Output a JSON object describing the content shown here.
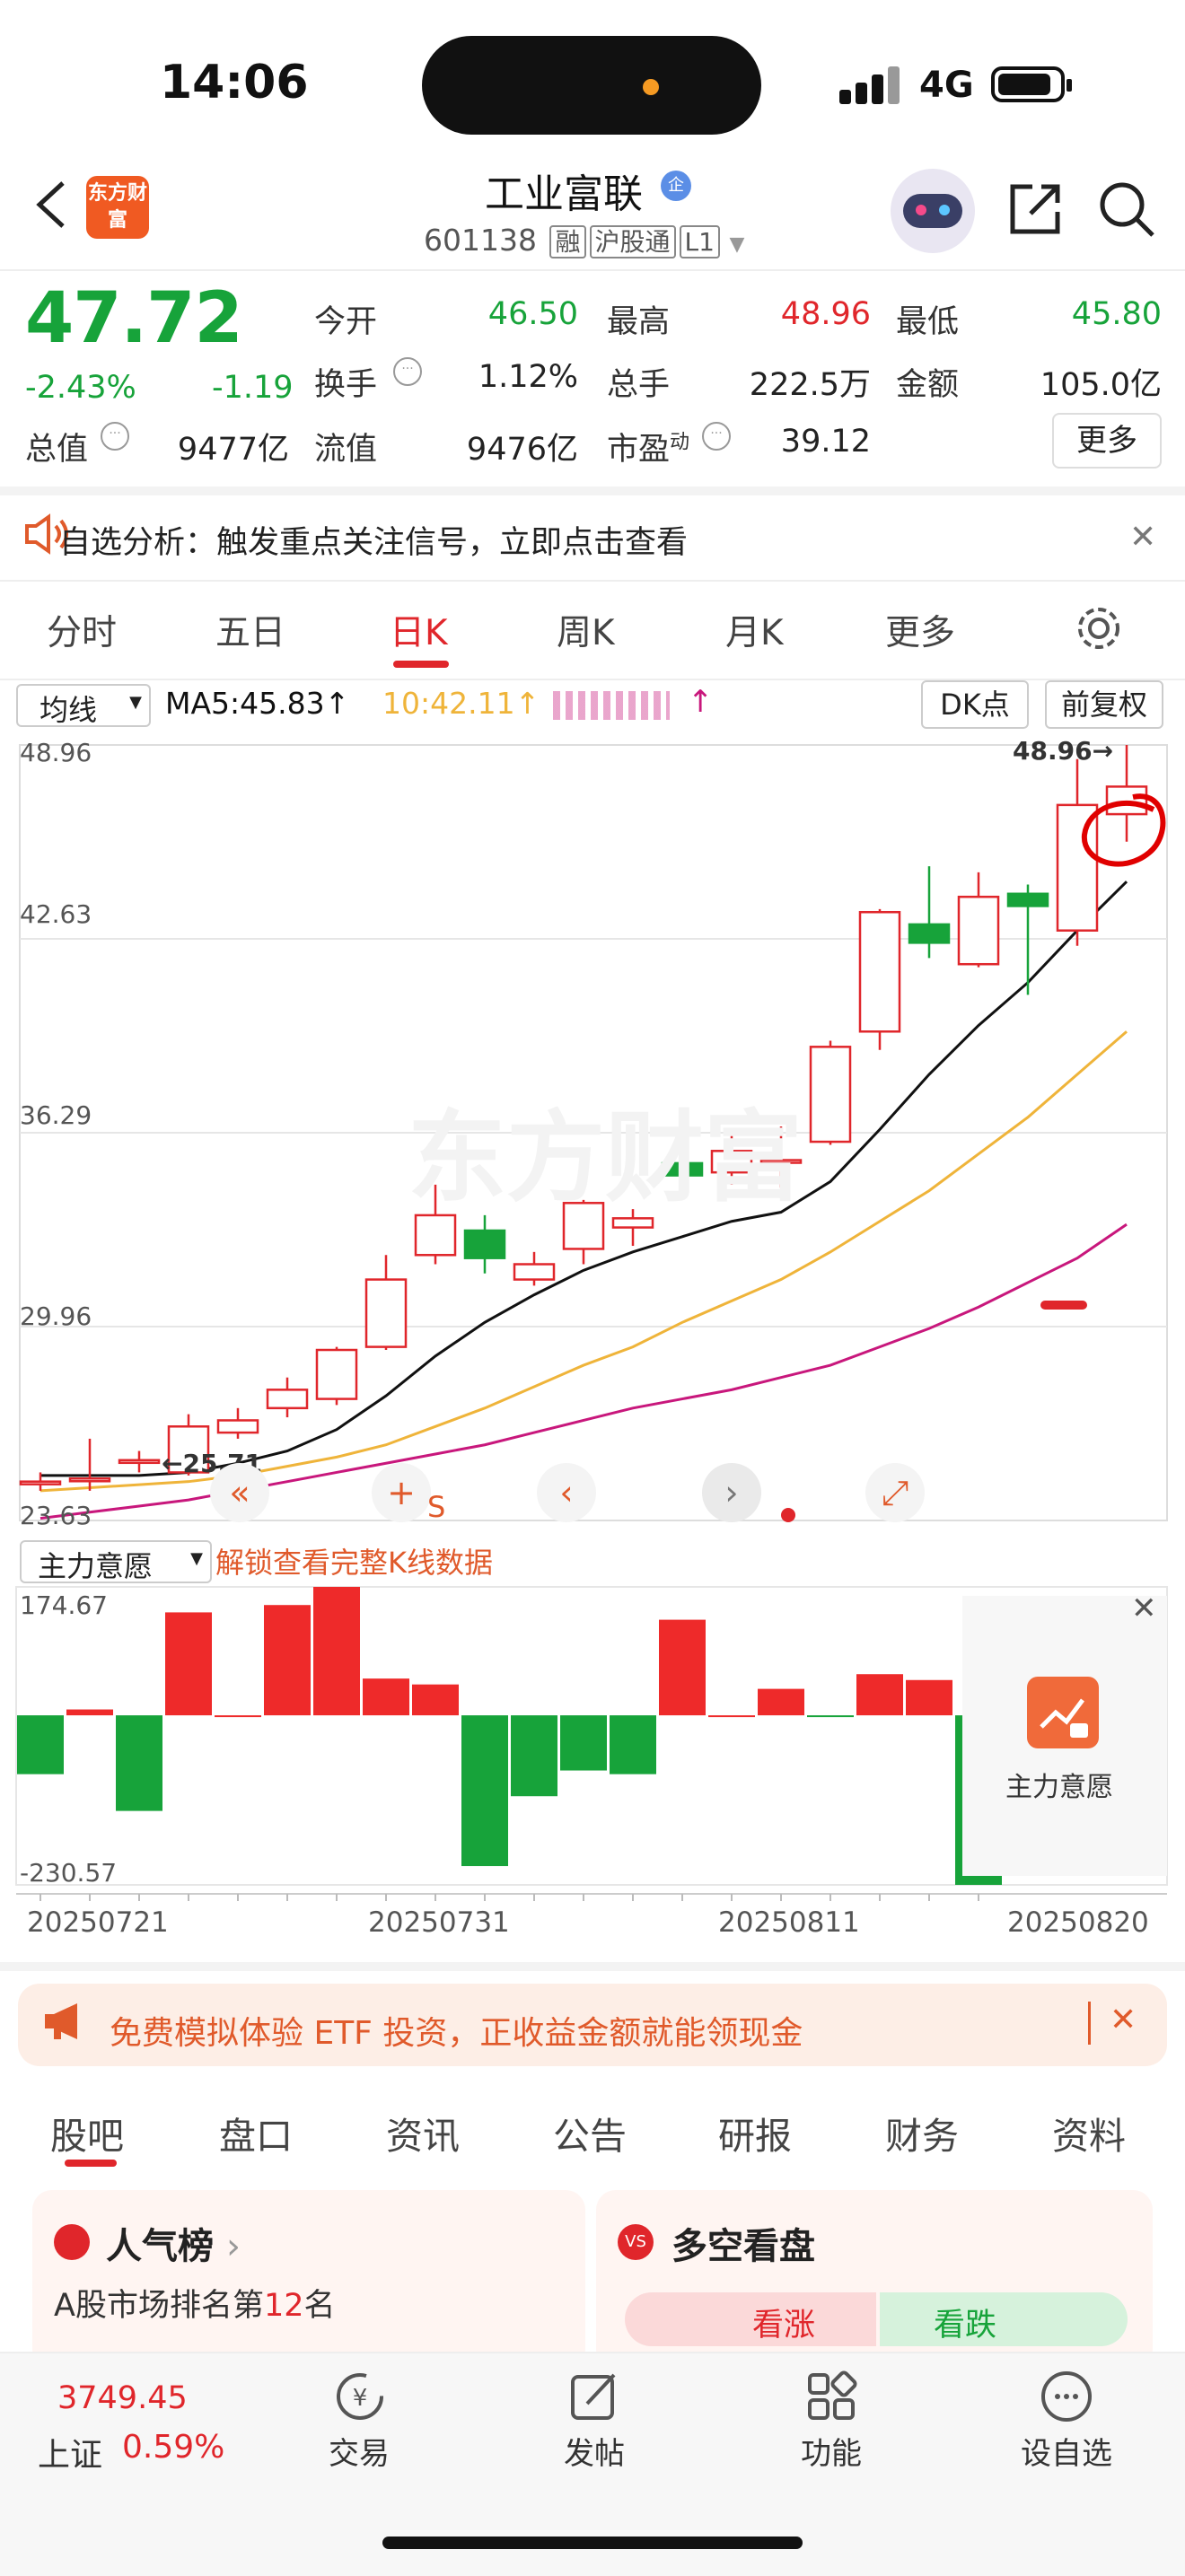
{
  "status": {
    "time": "14:06",
    "network": "4G"
  },
  "header": {
    "logo_text": "东方财富",
    "title": "工业富联",
    "title_badge": "企",
    "code": "601138",
    "tags": [
      "融",
      "沪股通",
      "L1"
    ]
  },
  "quote": {
    "price": "47.72",
    "change_pct": "-2.43%",
    "change_abs": "-1.19",
    "rows": [
      [
        {
          "label": "今开",
          "value": "46.50",
          "color": "#17a33a"
        },
        {
          "label": "最高",
          "value": "48.96",
          "color": "#e0262b"
        },
        {
          "label": "最低",
          "value": "45.80",
          "color": "#17a33a"
        }
      ],
      [
        {
          "label": "换手",
          "value": "1.12%",
          "color": "#222222"
        },
        {
          "label": "总手",
          "value": "222.5万",
          "color": "#222222"
        },
        {
          "label": "金额",
          "value": "105.0亿",
          "color": "#222222"
        }
      ]
    ],
    "total_value_label": "总值",
    "total_value": "9477亿",
    "float_value_label": "流值",
    "float_value": "9476亿",
    "pe_label": "市盈",
    "pe_sup": "动",
    "pe_value": "39.12",
    "more_label": "更多"
  },
  "notice": {
    "text": "自选分析：触发重点关注信号，立即点击查看"
  },
  "period_tabs": [
    "分时",
    "五日",
    "日K",
    "周K",
    "月K",
    "更多"
  ],
  "chart_toolbar": {
    "ma_select": "均线",
    "ma5": "MA5:45.83",
    "ma10": "10:42.11",
    "dk_label": "DK点",
    "adjust_label": "前复权",
    "max_marker": "48.96",
    "min_marker": "25.71"
  },
  "chart_data": [
    {
      "type": "candlestick",
      "title": "",
      "y_ticks": [
        "48.96",
        "42.63",
        "36.29",
        "29.96",
        "23.63"
      ],
      "ylim": [
        23.63,
        48.96
      ],
      "candles": [
        {
          "o": 24.9,
          "c": 24.9,
          "h": 25.2,
          "l": 24.6
        },
        {
          "o": 25.0,
          "c": 25.0,
          "h": 26.3,
          "l": 24.6
        },
        {
          "o": 25.6,
          "c": 25.6,
          "h": 25.9,
          "l": 25.2
        },
        {
          "o": 25.2,
          "c": 26.7,
          "h": 27.1,
          "l": 25.1
        },
        {
          "o": 26.5,
          "c": 26.9,
          "h": 27.3,
          "l": 26.3
        },
        {
          "o": 27.3,
          "c": 27.9,
          "h": 28.3,
          "l": 27.0
        },
        {
          "o": 27.6,
          "c": 29.2,
          "h": 29.3,
          "l": 27.4
        },
        {
          "o": 29.3,
          "c": 31.5,
          "h": 32.3,
          "l": 29.2
        },
        {
          "o": 32.3,
          "c": 33.6,
          "h": 34.6,
          "l": 32.0
        },
        {
          "o": 33.1,
          "c": 32.2,
          "h": 33.6,
          "l": 31.7
        },
        {
          "o": 31.5,
          "c": 32.0,
          "h": 32.4,
          "l": 31.3
        },
        {
          "o": 32.5,
          "c": 34.0,
          "h": 34.1,
          "l": 32.0
        },
        {
          "o": 33.2,
          "c": 33.5,
          "h": 33.8,
          "l": 32.6
        },
        {
          "o": 35.3,
          "c": 34.9,
          "h": 36.5,
          "l": 34.2
        },
        {
          "o": 35.0,
          "c": 35.7,
          "h": 36.3,
          "l": 34.6
        },
        {
          "o": 35.4,
          "c": 35.4,
          "h": 36.5,
          "l": 34.5
        },
        {
          "o": 36.0,
          "c": 39.1,
          "h": 39.3,
          "l": 35.9
        },
        {
          "o": 39.6,
          "c": 43.5,
          "h": 43.6,
          "l": 39.0
        },
        {
          "o": 43.1,
          "c": 42.5,
          "h": 45.0,
          "l": 42.0
        },
        {
          "o": 41.8,
          "c": 44.0,
          "h": 44.8,
          "l": 41.7
        },
        {
          "o": 44.1,
          "c": 43.7,
          "h": 44.4,
          "l": 40.8
        },
        {
          "o": 42.9,
          "c": 47.0,
          "h": 48.5,
          "l": 42.4
        },
        {
          "o": 46.7,
          "c": 47.6,
          "h": 48.96,
          "l": 45.8
        }
      ],
      "ma_lines": [
        {
          "name": "MA5",
          "values": [
            25.1,
            25.1,
            25.1,
            25.2,
            25.5,
            25.9,
            26.6,
            27.7,
            29.0,
            30.1,
            31.0,
            31.8,
            32.4,
            32.9,
            33.4,
            33.7,
            34.7,
            36.4,
            38.2,
            39.8,
            41.2,
            42.9,
            44.5
          ]
        },
        {
          "name": "MA10",
          "values": [
            24.6,
            24.7,
            24.8,
            24.9,
            25.1,
            25.4,
            25.7,
            26.1,
            26.7,
            27.3,
            28.0,
            28.7,
            29.3,
            30.1,
            30.8,
            31.5,
            32.4,
            33.4,
            34.4,
            35.6,
            36.8,
            38.2,
            39.6
          ]
        },
        {
          "name": "MA20",
          "values": [
            23.7,
            23.9,
            24.1,
            24.3,
            24.6,
            24.9,
            25.2,
            25.5,
            25.8,
            26.1,
            26.5,
            26.9,
            27.3,
            27.6,
            27.9,
            28.3,
            28.7,
            29.3,
            29.9,
            30.6,
            31.4,
            32.2,
            33.3
          ]
        }
      ],
      "colors": {
        "up": "#e0262b",
        "down": "#17a33a",
        "ma5": "#111111",
        "ma10": "#efb43a",
        "ma20": "#c8177c"
      }
    },
    {
      "type": "bar",
      "title": "主力意愿",
      "y_ticks": [
        "174.67",
        "-230.57"
      ],
      "ylim": [
        -230.57,
        174.67
      ],
      "values": [
        -80,
        8,
        -130,
        140,
        0,
        150,
        174.67,
        50,
        42,
        -205,
        -110,
        -75,
        -80,
        130,
        0,
        36,
        -2,
        56,
        48,
        -230.57
      ],
      "x_labels": [
        "20250721",
        "20250731",
        "20250811",
        "20250820"
      ]
    }
  ],
  "indicator": {
    "select_label": "主力意愿",
    "unlock_text": "解锁查看完整K线数据",
    "side_label": "主力意愿"
  },
  "promo": {
    "text": "免费模拟体验 ETF 投资，正收益金额就能领现金"
  },
  "sub_tabs": [
    "股吧",
    "盘口",
    "资讯",
    "公告",
    "研报",
    "财务",
    "资料"
  ],
  "cards": {
    "left_title": "人气榜",
    "left_line1_pre": "A股市场排名第",
    "left_rank": "12",
    "left_line1_post": "名",
    "right_title": "多空看盘",
    "right_up": "看涨",
    "right_down": "看跌"
  },
  "bottom_bar": {
    "index_value": "3749.45",
    "index_name": "上证",
    "index_change": "0.59%",
    "items": [
      "交易",
      "发帖",
      "功能",
      "设自选"
    ]
  }
}
